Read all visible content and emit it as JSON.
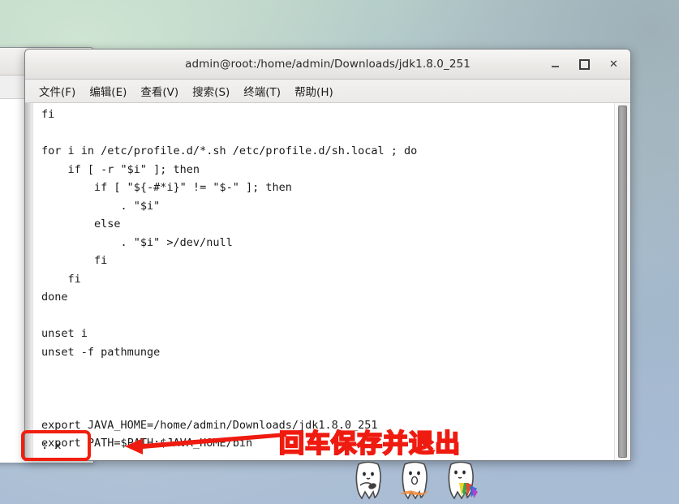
{
  "desktop": {
    "background_colors": [
      "#cfe4d2",
      "#b2c9cb",
      "#a3b7cd"
    ]
  },
  "background_window": {
    "name": "partially-hidden-window",
    "close_label": "✕"
  },
  "window": {
    "title": "admin@root:/home/admin/Downloads/jdk1.8.0_251",
    "buttons": {
      "minimize": "minimize",
      "maximize": "maximize",
      "close": "✕"
    }
  },
  "menubar": {
    "items": [
      {
        "label": "文件(F)",
        "name": "menu-file"
      },
      {
        "label": "编辑(E)",
        "name": "menu-edit"
      },
      {
        "label": "查看(V)",
        "name": "menu-view"
      },
      {
        "label": "搜索(S)",
        "name": "menu-search"
      },
      {
        "label": "终端(T)",
        "name": "menu-terminal"
      },
      {
        "label": "帮助(H)",
        "name": "menu-help"
      }
    ]
  },
  "terminal": {
    "editor": "vi",
    "file_content_lines": [
      "fi",
      "",
      "for i in /etc/profile.d/*.sh /etc/profile.d/sh.local ; do",
      "    if [ -r \"$i\" ]; then",
      "        if [ \"${-#*i}\" != \"$-\" ]; then",
      "            . \"$i\"",
      "        else",
      "            . \"$i\" >/dev/null",
      "        fi",
      "    fi",
      "done",
      "",
      "unset i",
      "unset -f pathmunge",
      "",
      "",
      "",
      "export JAVA_HOME=/home/admin/Downloads/jdk1.8.0_251",
      "export PATH=$PATH:$JAVA_HOME/bin"
    ],
    "status_line": ": x"
  },
  "annotation": {
    "text": "回车保存并退出",
    "color": "#ef1b10",
    "arrow": "left-arrow-pointing-to-status-line",
    "highlight_target": ": x"
  },
  "mascots": {
    "count": 3,
    "description": "cartoon-mascot-watermark"
  }
}
